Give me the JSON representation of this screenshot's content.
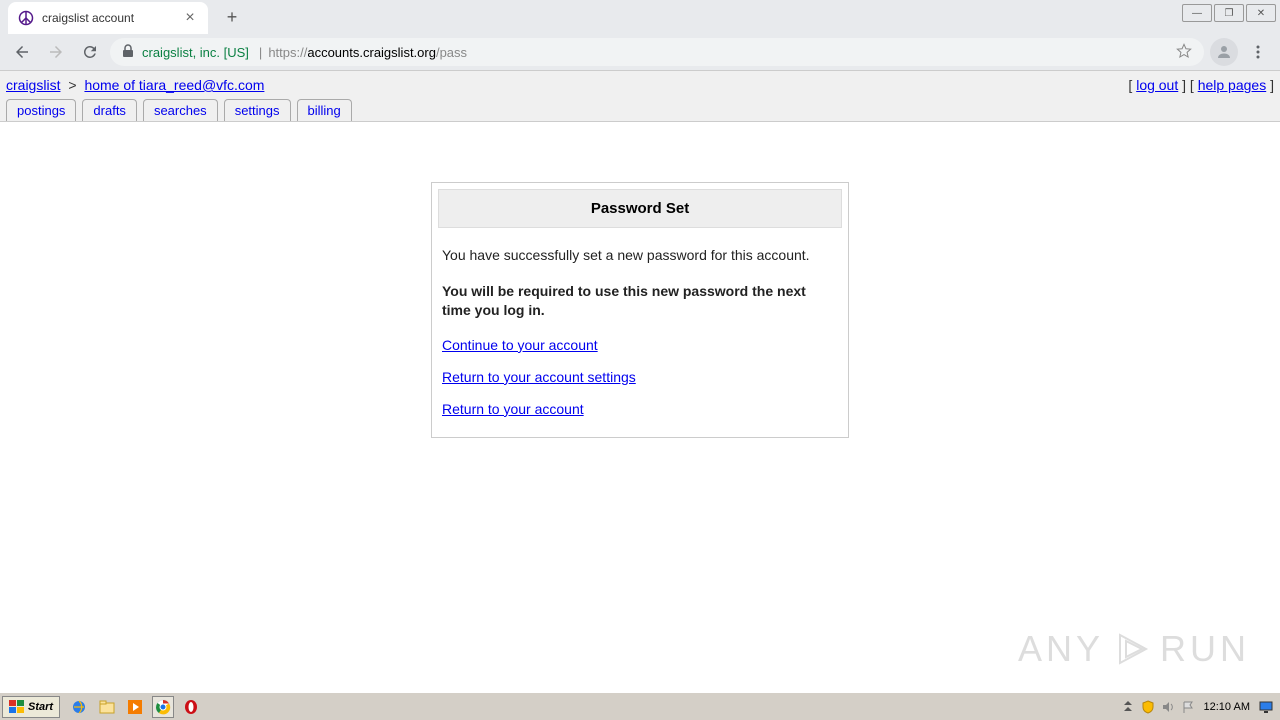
{
  "browser": {
    "tab_title": "craigslist account",
    "url_security": "craigslist, inc. [US]",
    "url_proto": "https://",
    "url_domain": "accounts.craigslist.org",
    "url_path": "/pass"
  },
  "breadcrumb": {
    "root": "craigslist",
    "sep": ">",
    "home_label": "home of tiara_reed@vfc.com",
    "logout": "log out",
    "help": "help pages"
  },
  "tabs": [
    "postings",
    "drafts",
    "searches",
    "settings",
    "billing"
  ],
  "panel": {
    "title": "Password Set",
    "msg1": "You have successfully set a new password for this account.",
    "msg2": "You will be required to use this new password the next time you log in.",
    "links": [
      "Continue to your account",
      "Return to your account settings",
      "Return to your account"
    ]
  },
  "taskbar": {
    "start": "Start",
    "clock": "12:10 AM"
  },
  "watermark": {
    "t1": "ANY",
    "t2": "RUN"
  }
}
